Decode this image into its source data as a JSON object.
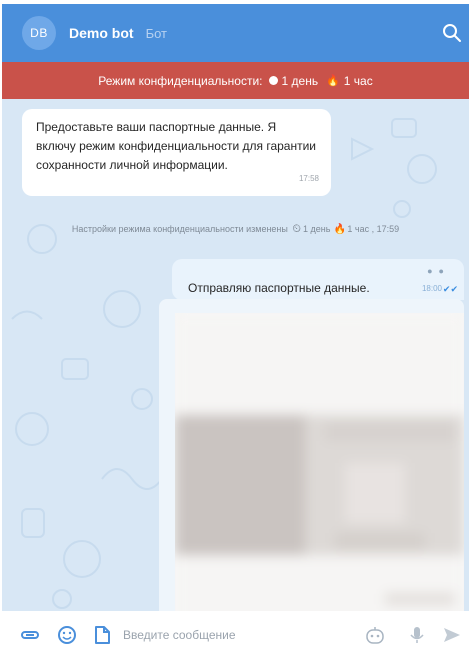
{
  "header": {
    "avatar_initials": "DB",
    "bot_name": "Demo bot",
    "bot_subtitle": "Бот"
  },
  "privacy_banner": {
    "label": "Режим конфиденциальности:",
    "read_timer": "1 день",
    "delete_timer": "1 час"
  },
  "messages": {
    "incoming": {
      "text": "Предоставьте ваши паспортные данные. Я включу режим конфиденциальности для гарантии сохранности личной информации.",
      "time": "17:58"
    },
    "system_notice": {
      "text": "Настройки режима конфиденциальности изменены",
      "read_timer": "1 день",
      "delete_timer": "1 час , 17:59"
    },
    "outgoing": {
      "text": "Отправляю паспортные данные.",
      "time": "18:00"
    }
  },
  "composer": {
    "placeholder": "Введите сообщение"
  },
  "colors": {
    "header": "#4a8fdb",
    "banner": "#c9524a",
    "chat_background": "#d8e7f5",
    "outgoing_bubble": "#e9f3fc"
  }
}
